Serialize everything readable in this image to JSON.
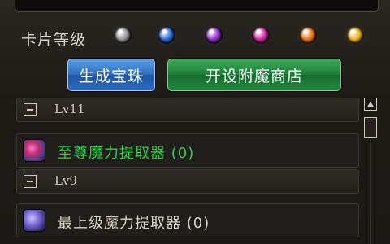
{
  "card_grade": {
    "label": "卡片等级",
    "orbs": [
      {
        "name": "gray",
        "color": "#9a9a9a"
      },
      {
        "name": "blue",
        "color": "#2f6fe0"
      },
      {
        "name": "purple",
        "color": "#9a32d8"
      },
      {
        "name": "magenta",
        "color": "#d82aa6"
      },
      {
        "name": "orange",
        "color": "#f07a18"
      },
      {
        "name": "gold",
        "color": "#f0b820"
      }
    ]
  },
  "buttons": {
    "generate": "生成宝珠",
    "open_shop": "开设附魔商店"
  },
  "list": [
    {
      "type": "category",
      "label": "Lv11"
    },
    {
      "type": "item",
      "label": "至尊魔力提取器 (0)",
      "color": "#2fd04a"
    },
    {
      "type": "category",
      "label": "Lv9"
    },
    {
      "type": "item",
      "label": "最上级魔力提取器 (0)",
      "color": "#d8d2c6"
    }
  ]
}
